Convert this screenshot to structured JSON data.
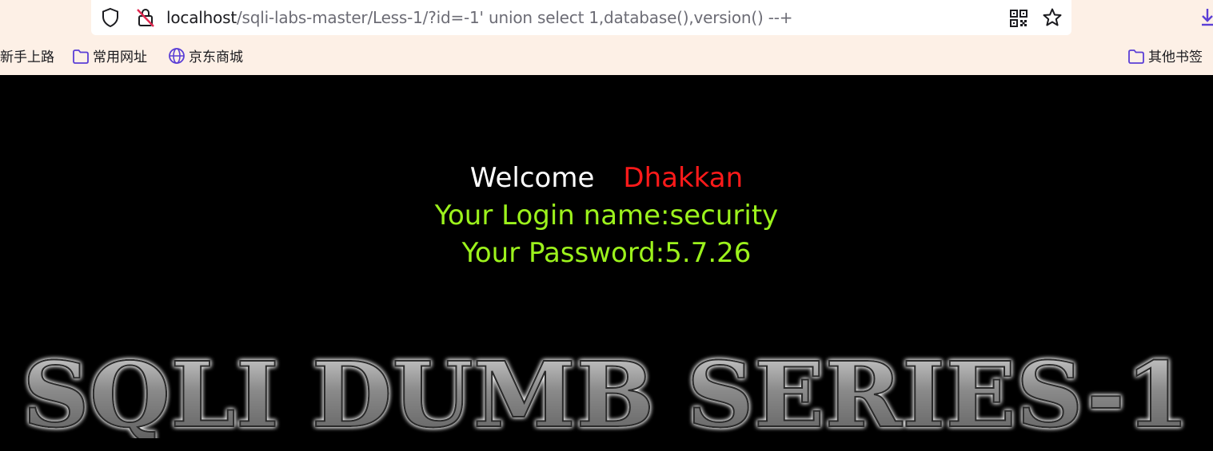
{
  "browser": {
    "url_host": "localhost",
    "url_path": "/sqli-labs-master/Less-1/?id=-1' union select 1,database(),version() --+",
    "icons": [
      "shield-icon",
      "insecure-lock-icon",
      "qr-code-icon",
      "star-icon",
      "download-icon"
    ]
  },
  "bookmarks": {
    "items": [
      {
        "label": "新手上路"
      },
      {
        "label": "常用网址",
        "icon": "folder-icon"
      },
      {
        "label": "京东商城",
        "icon": "globe-icon"
      }
    ],
    "other": {
      "label": "其他书签",
      "icon": "folder-icon"
    }
  },
  "page": {
    "welcome": "Welcome",
    "user": "Dhakkan",
    "login_line": "Your Login name:security",
    "password_line": "Your Password:5.7.26",
    "banner_text": "SQLI DUMB SERIES-1"
  },
  "colors": {
    "page_bg": "#000000",
    "welcome": "#ffffff",
    "user": "#ff1a1a",
    "result": "#9cf21c",
    "accent_icon": "#5b3fd6"
  }
}
